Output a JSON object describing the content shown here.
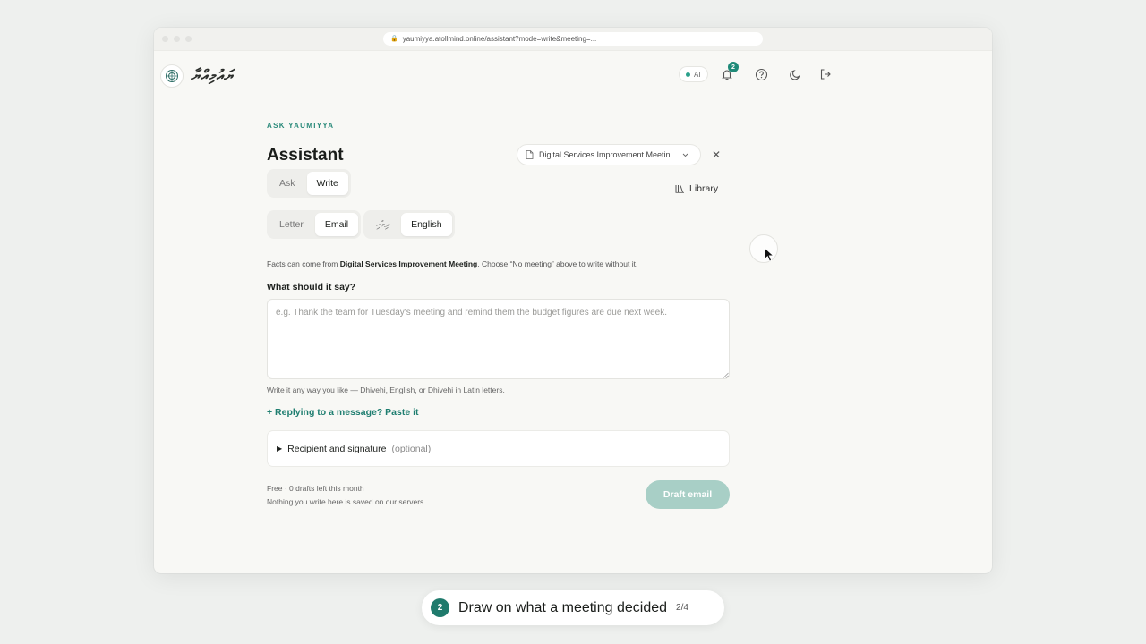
{
  "browser": {
    "url": "yaumiyya.atollmind.online/assistant?mode=write&meeting=..."
  },
  "header": {
    "brand": "ޔައުމިއްޔާ",
    "ai_label": "AI",
    "notification_count": "2",
    "icons": [
      "logo-icon",
      "bell-icon",
      "help-icon",
      "moon-icon",
      "logout-icon"
    ]
  },
  "page": {
    "eyebrow": "ASK YAUMIYYA",
    "title": "Assistant",
    "meeting_selector": "Digital Services Improvement Meetin...",
    "mode_tabs": [
      "Ask",
      "Write"
    ],
    "active_mode": "Write",
    "library_label": "Library",
    "type_tabs": [
      "Letter",
      "Email"
    ],
    "active_type": "Email",
    "language_tabs": [
      "ދިވެހި",
      "English"
    ],
    "active_language": "English",
    "facts_prefix": "Facts can come from ",
    "facts_meeting": "Digital Services Improvement Meeting",
    "facts_suffix": ". Choose “No meeting” above to write without it.",
    "prompt_label": "What should it say?",
    "prompt_placeholder": "e.g. Thank the team for Tuesday's meeting and remind them the budget figures are due next week.",
    "prompt_hint": "Write it any way you like — Dhivehi, English, or Dhivehi in Latin letters.",
    "reply_link": "+ Replying to a message? Paste it",
    "recipient_label": "Recipient and signature",
    "recipient_optional": "(optional)",
    "quota_line1": "Free · 0 drafts left this month",
    "quota_line2": "Nothing you write here is saved on our servers.",
    "draft_button": "Draft email"
  },
  "tour": {
    "step_number": "2",
    "step_text": "Draw on what a meeting decided",
    "step_count": "2/4"
  },
  "colors": {
    "accent": "#1f7e70",
    "disabled_button": "#a8cfc6",
    "background": "#f8f8f5"
  }
}
